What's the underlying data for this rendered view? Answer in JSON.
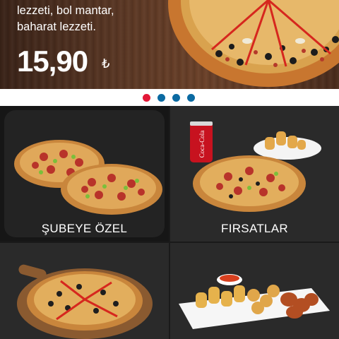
{
  "banner": {
    "line1": "lezzeti, bol mantar,",
    "line2": "baharat lezzeti.",
    "price": "15,90",
    "currency": "₺"
  },
  "pager": {
    "dot_count": 4,
    "active_index": 0,
    "active_color": "#e31837",
    "inactive_color": "#0b6aa2"
  },
  "tiles": [
    {
      "label": "ŞUBEYE ÖZEL"
    },
    {
      "label": "FIRSATLAR"
    },
    {
      "label": ""
    },
    {
      "label": ""
    }
  ]
}
